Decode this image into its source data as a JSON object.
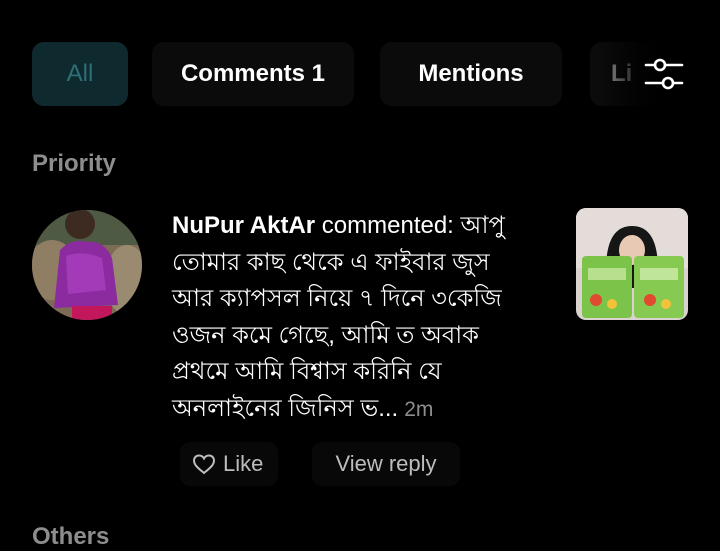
{
  "tabs": [
    {
      "label": "All",
      "active": true
    },
    {
      "label": "Comments 1",
      "active": false
    },
    {
      "label": "Mentions",
      "active": false
    },
    {
      "label": "Li",
      "active": false
    }
  ],
  "sections": {
    "priority": "Priority",
    "others": "Others"
  },
  "notification": {
    "username": "NuPur AktAr",
    "action": " commented: ",
    "text": "আপু তোমার কাছ থেকে এ ফাইবার জুস আর ক্যাপসল নিয়ে ৭ দিনে ৩কেজি ওজন কমে গেছে, আমি ত অবাক প্রথমে আমি বিশ্বাস করিনি যে অনলাইনের জিনিস ভ...",
    "time": "2m",
    "like_label": "Like",
    "reply_label": "View reply"
  },
  "icons": [
    "sliders-icon",
    "heart-icon"
  ],
  "colors": {
    "background": "#000000",
    "active_tab_bg": "#0e2a2f",
    "active_tab_text": "#2e6f78",
    "muted_text": "#8d8d8d"
  }
}
